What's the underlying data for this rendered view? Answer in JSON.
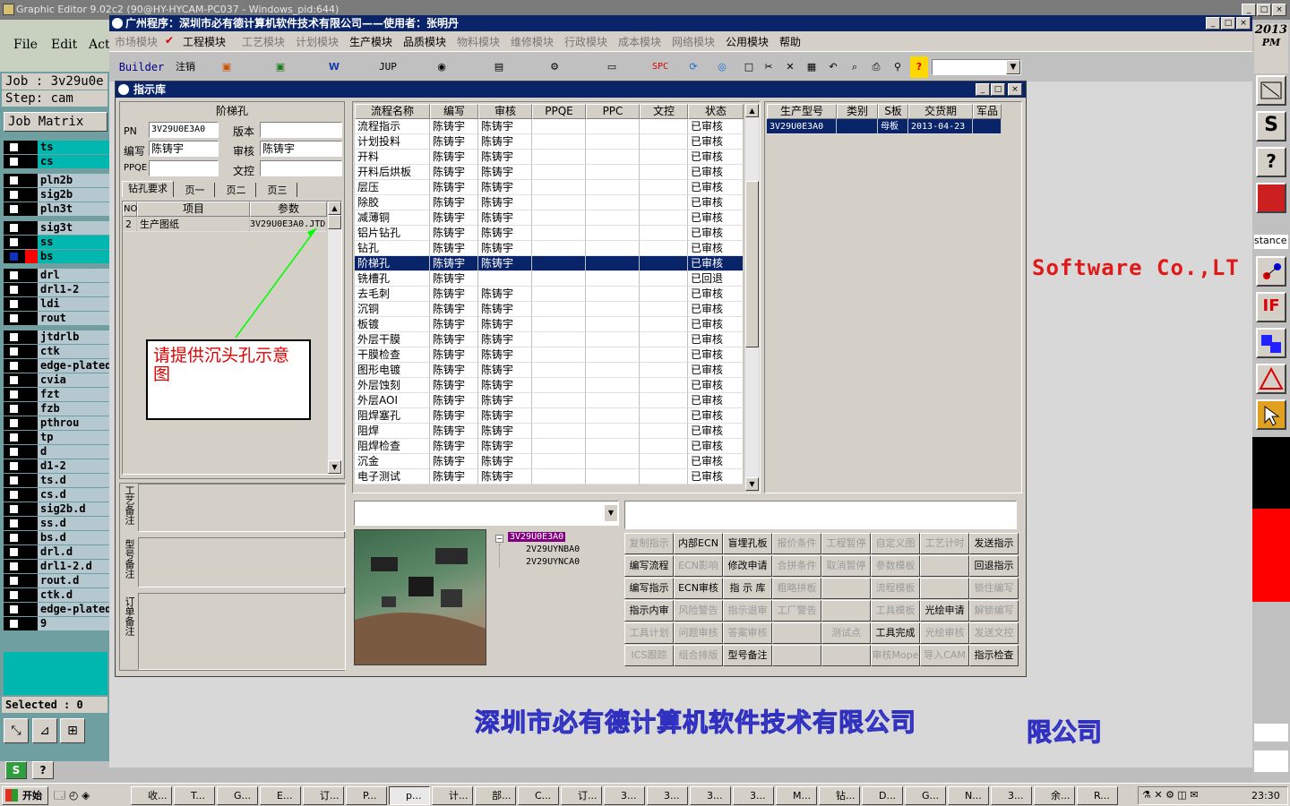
{
  "ge": {
    "title": "Graphic Editor 9.02c2 (90@HY-HYCAM-PC037 - Windows_pid:644)",
    "menu": [
      "File",
      "Edit",
      "Act"
    ],
    "job_label": "Job  :  3v29u0e",
    "step_label": "Step:  cam",
    "job_matrix": "Job Matrix",
    "selected": "Selected : 0",
    "clock_year": "2013",
    "clock_ampm": "PM",
    "stance": "stance"
  },
  "layers": [
    "ts",
    "cs",
    "pln2b",
    "sig2b",
    "pln3t",
    "sig3t",
    "ss",
    "bs",
    "drl",
    "drl1-2",
    "ldi",
    "rout",
    "jtdrlb",
    "ctk",
    "edge-plated",
    "cvia",
    "fzt",
    "fzb",
    "pthrou",
    "tp",
    "d",
    "d1-2",
    "ts.d",
    "cs.d",
    "sig2b.d",
    "ss.d",
    "bs.d",
    "drl.d",
    "drl1-2.d",
    "rout.d",
    "ctk.d",
    "edge-plated",
    "9"
  ],
  "app": {
    "title": "广州程序：深圳市必有德计算机软件技术有限公司——使用者：张明丹",
    "menu": [
      "市场模块",
      "工程模块",
      "工艺模块",
      "计划模块",
      "生产模块",
      "品质模块",
      "物料模块",
      "维修模块",
      "行政模块",
      "成本模块",
      "网络模块",
      "公用模块",
      "帮助"
    ],
    "toolbar": {
      "builder": "Builder",
      "logout": "注销",
      "jup": "JUP",
      "spc": "SPC"
    }
  },
  "dialog": {
    "title": "指示库",
    "section_title": "阶梯孔",
    "labels": {
      "pn": "PN",
      "version": "版本",
      "writer": "编写",
      "reviewer": "审核",
      "ppqe": "PPQE",
      "control": "文控"
    },
    "values": {
      "pn": "3V29U0E3A0",
      "version": "",
      "writer": "陈铸宇",
      "reviewer": "陈铸宇",
      "ppqe": "",
      "control": ""
    },
    "tabs": [
      "钻孔要求",
      "页一",
      "页二",
      "页三"
    ],
    "item_headers": [
      "NO",
      "项目",
      "参数"
    ],
    "items": [
      {
        "no": "2",
        "item": "生产图纸",
        "param": "3V29U0E3A0.JTD"
      }
    ],
    "annotation": "请提供沉头孔示意图",
    "remark_labels": [
      "工艺备注",
      "型号备注",
      "订单备注"
    ],
    "flow_headers": [
      "流程名称",
      "编写",
      "审核",
      "PPQE",
      "PPC",
      "文控",
      "状态"
    ],
    "flows": [
      [
        "流程指示",
        "陈铸宇",
        "陈铸宇",
        "",
        "",
        "",
        "已审核"
      ],
      [
        "计划投料",
        "陈铸宇",
        "陈铸宇",
        "",
        "",
        "",
        "已审核"
      ],
      [
        "开料",
        "陈铸宇",
        "陈铸宇",
        "",
        "",
        "",
        "已审核"
      ],
      [
        "开料后烘板",
        "陈铸宇",
        "陈铸宇",
        "",
        "",
        "",
        "已审核"
      ],
      [
        "层压",
        "陈铸宇",
        "陈铸宇",
        "",
        "",
        "",
        "已审核"
      ],
      [
        "除胶",
        "陈铸宇",
        "陈铸宇",
        "",
        "",
        "",
        "已审核"
      ],
      [
        "减薄铜",
        "陈铸宇",
        "陈铸宇",
        "",
        "",
        "",
        "已审核"
      ],
      [
        "铝片钻孔",
        "陈铸宇",
        "陈铸宇",
        "",
        "",
        "",
        "已审核"
      ],
      [
        "钻孔",
        "陈铸宇",
        "陈铸宇",
        "",
        "",
        "",
        "已审核"
      ],
      [
        "阶梯孔",
        "陈铸宇",
        "陈铸宇",
        "",
        "",
        "",
        "已审核"
      ],
      [
        "铣槽孔",
        "陈铸宇",
        "",
        "",
        "",
        "",
        "已回退"
      ],
      [
        "去毛刺",
        "陈铸宇",
        "陈铸宇",
        "",
        "",
        "",
        "已审核"
      ],
      [
        "沉铜",
        "陈铸宇",
        "陈铸宇",
        "",
        "",
        "",
        "已审核"
      ],
      [
        "板镀",
        "陈铸宇",
        "陈铸宇",
        "",
        "",
        "",
        "已审核"
      ],
      [
        "外层干膜",
        "陈铸宇",
        "陈铸宇",
        "",
        "",
        "",
        "已审核"
      ],
      [
        "干膜检查",
        "陈铸宇",
        "陈铸宇",
        "",
        "",
        "",
        "已审核"
      ],
      [
        "图形电镀",
        "陈铸宇",
        "陈铸宇",
        "",
        "",
        "",
        "已审核"
      ],
      [
        "外层蚀刻",
        "陈铸宇",
        "陈铸宇",
        "",
        "",
        "",
        "已审核"
      ],
      [
        "外层AOI",
        "陈铸宇",
        "陈铸宇",
        "",
        "",
        "",
        "已审核"
      ],
      [
        "阻焊塞孔",
        "陈铸宇",
        "陈铸宇",
        "",
        "",
        "",
        "已审核"
      ],
      [
        "阻焊",
        "陈铸宇",
        "陈铸宇",
        "",
        "",
        "",
        "已审核"
      ],
      [
        "阻焊检查",
        "陈铸宇",
        "陈铸宇",
        "",
        "",
        "",
        "已审核"
      ],
      [
        "沉金",
        "陈铸宇",
        "陈铸宇",
        "",
        "",
        "",
        "已审核"
      ],
      [
        "电子测试",
        "陈铸宇",
        "陈铸宇",
        "",
        "",
        "",
        "已审核"
      ]
    ],
    "selected_flow": 9,
    "model_headers": [
      "生产型号",
      "类别",
      "S板",
      "交货期",
      "军品"
    ],
    "model_row": [
      "3V29U0E3A0",
      "",
      "母板",
      "2013-04-23",
      ""
    ],
    "tree": [
      "3V29U0E3A0",
      "2V29UYNBA0",
      "2V29UYNCA0"
    ],
    "buttons": [
      [
        {
          "t": "复制指示",
          "d": true
        },
        {
          "t": "内部ECN",
          "d": false
        },
        {
          "t": "盲埋孔板",
          "d": false
        },
        {
          "t": "报价条件",
          "d": true
        },
        {
          "t": "工程暂停",
          "d": true
        },
        {
          "t": "自定义图",
          "d": true
        },
        {
          "t": "工艺计时",
          "d": true
        },
        {
          "t": "发送指示",
          "d": false
        }
      ],
      [
        {
          "t": "编写流程",
          "d": false
        },
        {
          "t": "ECN影响",
          "d": true
        },
        {
          "t": "修改申请",
          "d": false
        },
        {
          "t": "合拼条件",
          "d": true
        },
        {
          "t": "取消暂停",
          "d": true
        },
        {
          "t": "参数模板",
          "d": true
        },
        {
          "t": "",
          "d": true
        },
        {
          "t": "回退指示",
          "d": false
        }
      ],
      [
        {
          "t": "编写指示",
          "d": false
        },
        {
          "t": "ECN审核",
          "d": false
        },
        {
          "t": "指 示 库",
          "d": false
        },
        {
          "t": "粗略拼板",
          "d": true
        },
        {
          "t": "",
          "d": true
        },
        {
          "t": "流程模板",
          "d": true
        },
        {
          "t": "",
          "d": true
        },
        {
          "t": "锁住编写",
          "d": true
        }
      ],
      [
        {
          "t": "指示内审",
          "d": false
        },
        {
          "t": "风险警告",
          "d": true
        },
        {
          "t": "指示退审",
          "d": true
        },
        {
          "t": "工厂警告",
          "d": true
        },
        {
          "t": "",
          "d": true
        },
        {
          "t": "工具模板",
          "d": true
        },
        {
          "t": "光绘申请",
          "d": false
        },
        {
          "t": "解锁编写",
          "d": true
        }
      ],
      [
        {
          "t": "工具计划",
          "d": true
        },
        {
          "t": "问题审核",
          "d": true
        },
        {
          "t": "答案审核",
          "d": true
        },
        {
          "t": "",
          "d": true
        },
        {
          "t": "测试点",
          "d": true
        },
        {
          "t": "工具完成",
          "d": false
        },
        {
          "t": "光绘审核",
          "d": true
        },
        {
          "t": "发送文控",
          "d": true
        }
      ],
      [
        {
          "t": "ICS跟踪",
          "d": true
        },
        {
          "t": "组合排版",
          "d": true
        },
        {
          "t": "型号备注",
          "d": false
        },
        {
          "t": "",
          "d": true
        },
        {
          "t": "",
          "d": true
        },
        {
          "t": "审核Mope",
          "d": true
        },
        {
          "t": "导入CAM",
          "d": true
        },
        {
          "t": "指示检查",
          "d": false
        }
      ]
    ]
  },
  "background": {
    "software_text": "Software Co.,LT",
    "company": "深圳市必有德计算机软件技术有限公司",
    "company_tail": "限公司"
  },
  "taskbar": {
    "start": "开始",
    "tasks": [
      "收...",
      "T...",
      "G...",
      "E...",
      "订...",
      "P...",
      "p...",
      "计...",
      "部...",
      "C...",
      "订...",
      "3...",
      "3...",
      "3...",
      "3...",
      "M...",
      "钻...",
      "D...",
      "G...",
      "N...",
      "3...",
      "余...",
      "R..."
    ],
    "clock": "23:30"
  },
  "colors": {
    "title_blue": "#0a246a",
    "select_blue": "#0a246a",
    "cyan_layer": "#00b7b0",
    "red": "#ff0000",
    "purple": "#800080"
  }
}
